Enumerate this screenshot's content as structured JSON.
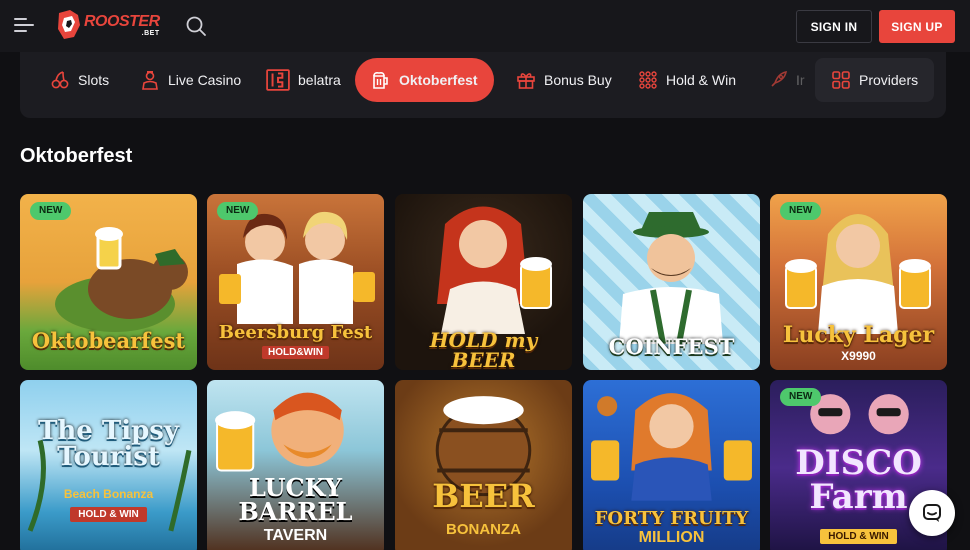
{
  "header": {
    "logo_title": "ROOSTER",
    "logo_sub": ".BET",
    "sign_in": "SIGN IN",
    "sign_up": "SIGN UP"
  },
  "categories": [
    {
      "label": "Slots",
      "icon": "cherry-icon"
    },
    {
      "label": "Live Casino",
      "icon": "dealer-icon"
    },
    {
      "label": "belatra",
      "icon": "belatra-icon"
    },
    {
      "label": "Oktoberfest",
      "icon": "beer-mug-icon",
      "active": true
    },
    {
      "label": "Bonus Buy",
      "icon": "gift-icon"
    },
    {
      "label": "Hold & Win",
      "icon": "grid-dots-icon"
    },
    {
      "label": "Ir",
      "icon": "rocket-icon"
    },
    {
      "label": "Providers",
      "icon": "grid-icon"
    }
  ],
  "section_title": "Oktoberfest",
  "badge_new": "NEW",
  "games": [
    {
      "title": "Oktobearfest",
      "sub": "",
      "new": true
    },
    {
      "title": "Beersburg Fest",
      "sub": "HOLD&WIN",
      "new": true
    },
    {
      "title": "HOLD my BEER",
      "sub": "",
      "new": false
    },
    {
      "title": "COINFEST",
      "sub": "",
      "new": false
    },
    {
      "title": "Lucky Lager",
      "sub": "X9990",
      "new": true
    },
    {
      "title": "The Tipsy Tourist",
      "sub": "Beach Bonanza",
      "sub2": "HOLD & WIN",
      "new": false
    },
    {
      "title": "LUCKY BARREL",
      "sub": "TAVERN",
      "new": false
    },
    {
      "title": "BEER",
      "sub": "BONANZA",
      "new": false
    },
    {
      "title": "FORTY FRUITY",
      "sub": "MILLION",
      "new": false
    },
    {
      "title": "DISCO Farm",
      "sub": "HOLD & WIN",
      "new": true
    }
  ],
  "colors": {
    "accent": "#e8453c",
    "background": "#101013",
    "header": "#17171b",
    "badge": "#4ec86c"
  }
}
